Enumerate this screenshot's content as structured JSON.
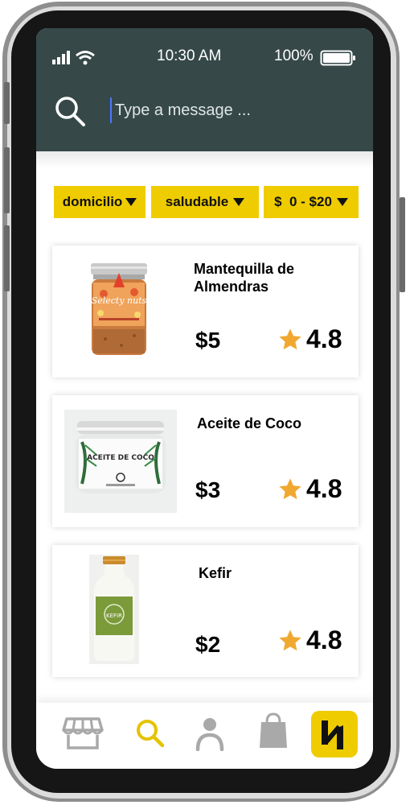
{
  "status_bar": {
    "time": "10:30 AM",
    "battery": "100%"
  },
  "search": {
    "placeholder": "Type a message ..."
  },
  "filters": [
    {
      "label": "domicilio"
    },
    {
      "label": "saludable"
    },
    {
      "label": "$  0 - $20"
    }
  ],
  "products": [
    {
      "name": "Mantequilla de Almendras",
      "price": "$5",
      "rating": "4.8",
      "image": "almond-butter-jar"
    },
    {
      "name": "Aceite de Coco",
      "price": "$3",
      "rating": "4.8",
      "image": "coconut-oil-jar"
    },
    {
      "name": "Kefir",
      "price": "$2",
      "rating": "4.8",
      "image": "kefir-bottle"
    }
  ],
  "product_labels": {
    "jar1_brand": "Selecty nuts",
    "jar2_brand": "ACEITE DE COCO",
    "bottle_brand": "KEFIR"
  },
  "nav": [
    {
      "icon": "store-icon",
      "active": false
    },
    {
      "icon": "search-icon",
      "active": true
    },
    {
      "icon": "user-icon",
      "active": false
    },
    {
      "icon": "shopping-bag-icon",
      "active": false
    },
    {
      "icon": "app-logo-icon",
      "active": false
    }
  ],
  "colors": {
    "header_bg": "#364848",
    "accent_yellow": "#efcc00",
    "star": "#f0a830",
    "nav_inactive": "#a9a9a9"
  }
}
